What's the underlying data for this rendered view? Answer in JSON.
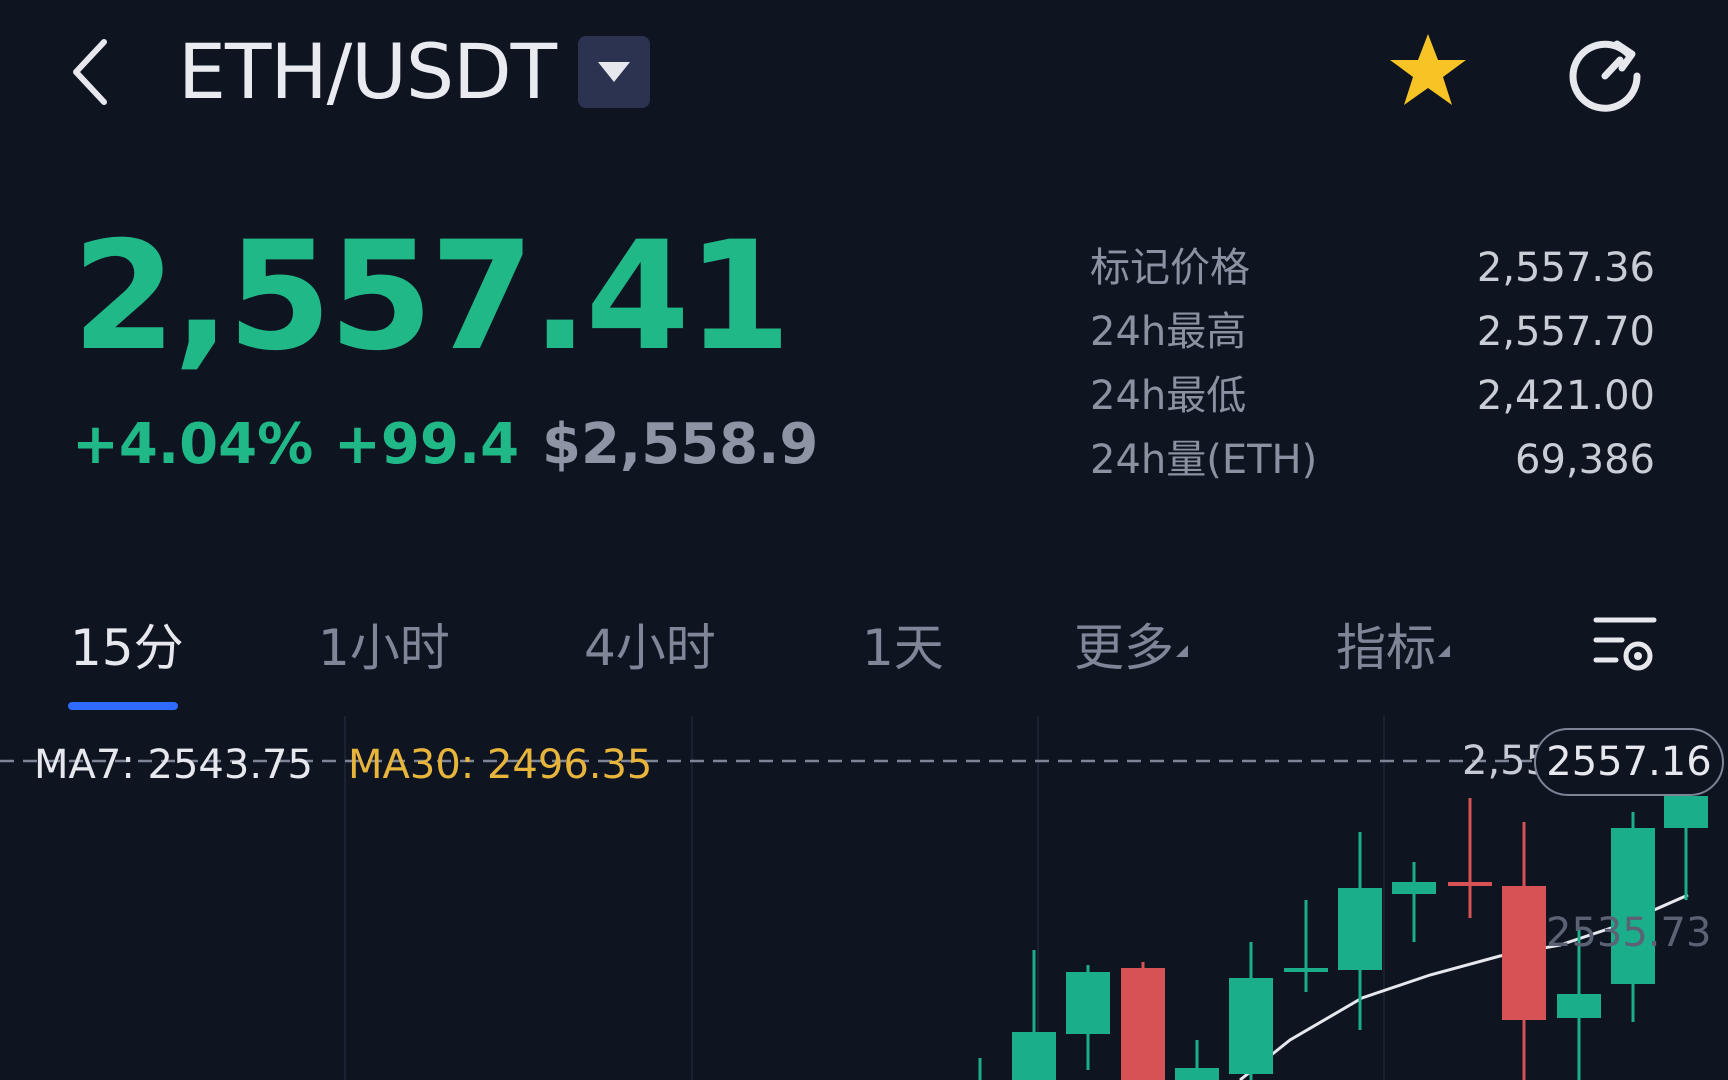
{
  "header": {
    "pair": "ETH/USDT",
    "icons": {
      "back": "chevron-left-icon",
      "dropdown": "caret-down-icon",
      "favorite": "star-icon",
      "refresh": "refresh-icon"
    },
    "favorite_color": "#f7c325"
  },
  "ticker": {
    "price": "2,557.41",
    "change_pct": "+4.04%",
    "change_abs": "+99.4",
    "usd_price": "$2,558.9",
    "price_color": "#20b887"
  },
  "stats": [
    {
      "label": "标记价格",
      "value": "2,557.36"
    },
    {
      "label": "24h最高",
      "value": "2,557.70"
    },
    {
      "label": "24h最低",
      "value": "2,421.00"
    },
    {
      "label": "24h量(ETH)",
      "value": "69,386"
    }
  ],
  "tabs": [
    {
      "label": "15分",
      "active": true
    },
    {
      "label": "1小时"
    },
    {
      "label": "4小时"
    },
    {
      "label": "1天"
    },
    {
      "label": "更多",
      "dropdown": true
    },
    {
      "label": "指标",
      "dropdown": true
    }
  ],
  "chart": {
    "ma7_label": "MA7: 2543.75",
    "ma30_label": "MA30: 2496.35",
    "axis_label_partial": "2,557",
    "current_price": "2557.16",
    "ma_end_label": "2535.73",
    "colors": {
      "up": "#1bae8a",
      "down": "#d65254",
      "ma7": "#e6e8ee",
      "ma30": "#e7b43c",
      "accent": "#2f6bff"
    }
  },
  "chart_data": {
    "type": "candlestick",
    "series": [
      {
        "name": "MA7",
        "last": 2543.75
      },
      {
        "name": "MA30",
        "last": 2496.35
      }
    ],
    "last_price": 2557.16
  }
}
